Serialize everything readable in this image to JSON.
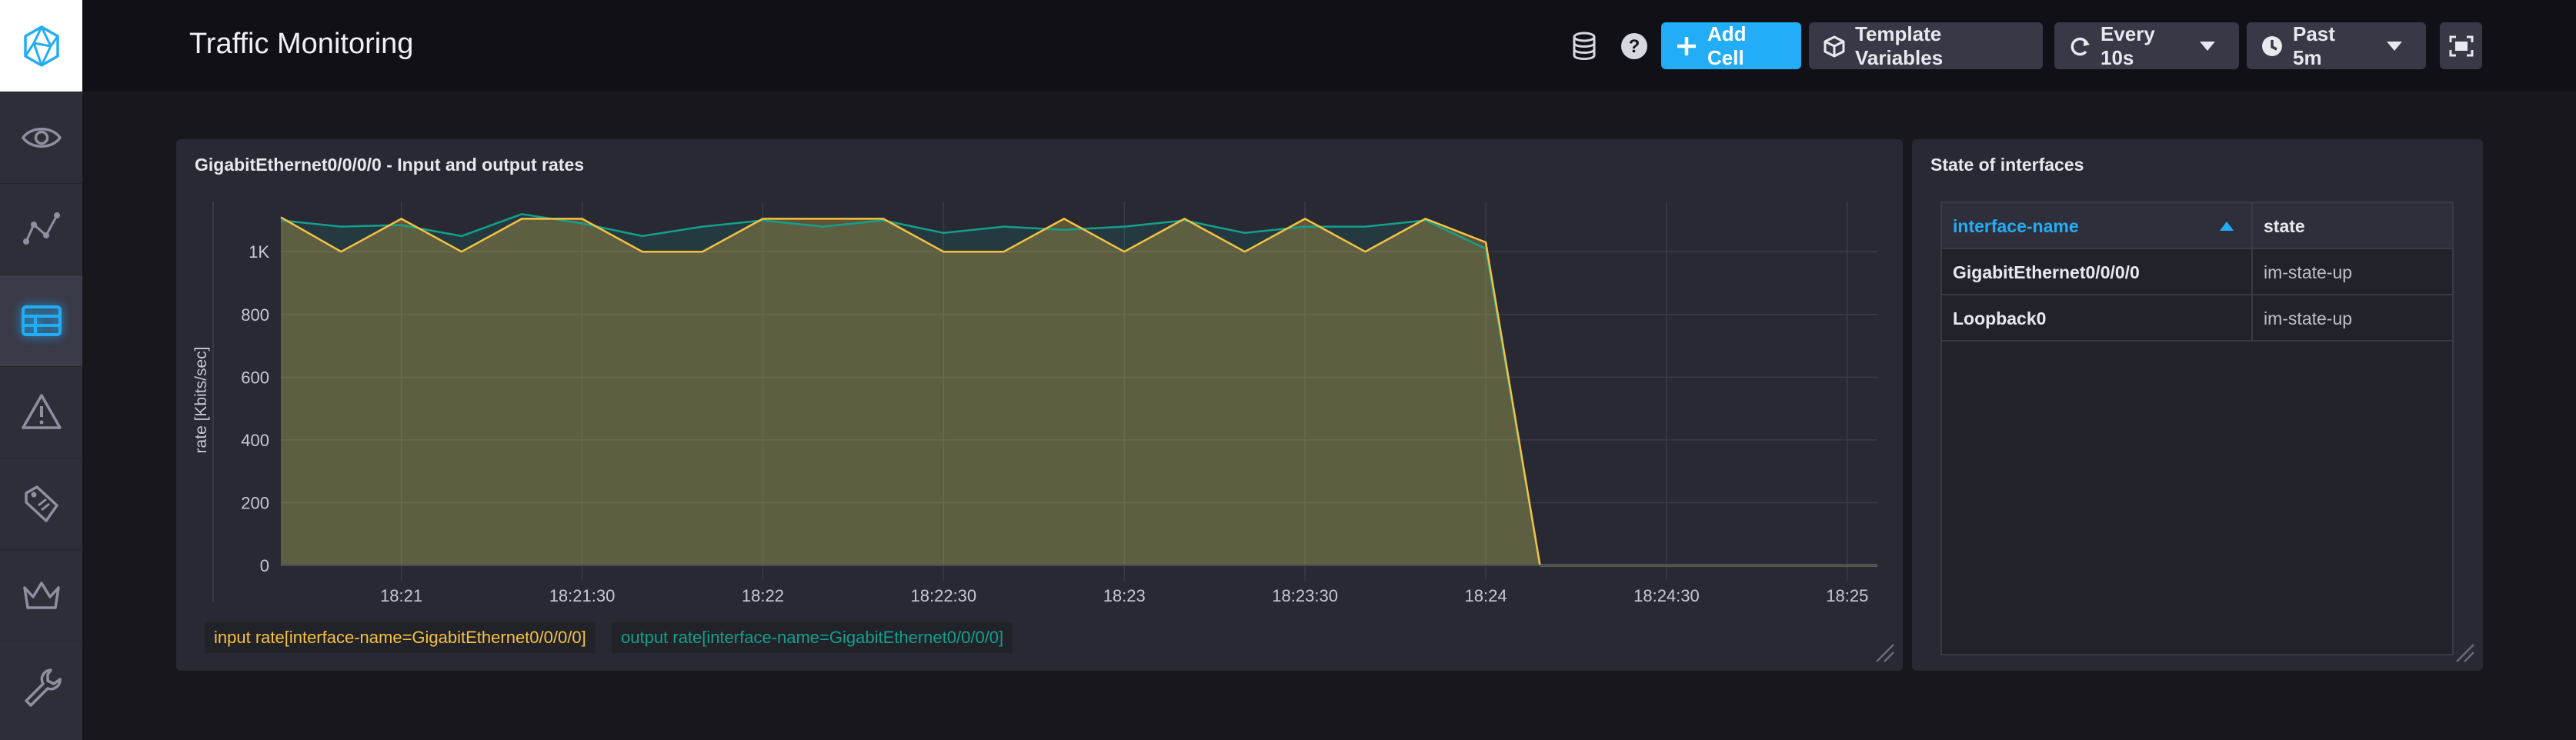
{
  "header": {
    "title": "Traffic Monitoring",
    "add_cell_label": "Add Cell",
    "template_variables_label": "Template Variables",
    "refresh_label": "Every 10s",
    "time_range_label": "Past 5m"
  },
  "sidebar": {
    "items": [
      {
        "icon": "eye-icon"
      },
      {
        "icon": "graph-icon"
      },
      {
        "icon": "dashboard-icon",
        "active": true
      },
      {
        "icon": "alert-icon"
      },
      {
        "icon": "tag-icon"
      },
      {
        "icon": "crown-icon"
      },
      {
        "icon": "wrench-icon"
      }
    ]
  },
  "colors": {
    "accent": "#22adf6",
    "input_series": "#f5c242",
    "output_series": "#12a08c",
    "state_up": "#bfbfc8"
  },
  "chart_cell": {
    "title": "GigabitEthernet0/0/0/0 - Input and output rates"
  },
  "chart_data": {
    "type": "area",
    "title": "GigabitEthernet0/0/0/0 - Input and output rates",
    "ylabel": "rate [Kbits/sec]",
    "xlabel": "",
    "ylim": [
      0,
      1160
    ],
    "xlim": [
      "18:20:40",
      "18:25:05"
    ],
    "y_ticks": [
      "0",
      "200",
      "400",
      "600",
      "800",
      "1K"
    ],
    "y_tick_values": [
      0,
      200,
      400,
      600,
      800,
      1000
    ],
    "x_ticks": [
      "18:21",
      "18:21:30",
      "18:22",
      "18:22:30",
      "18:23",
      "18:23:30",
      "18:24",
      "18:24:30",
      "18:25"
    ],
    "x_tick_times": [
      "18:21:00",
      "18:21:30",
      "18:22:00",
      "18:22:30",
      "18:23:00",
      "18:23:30",
      "18:24:00",
      "18:24:30",
      "18:25:00"
    ],
    "grid": true,
    "legend_position": "bottom-left",
    "series": [
      {
        "name": "input rate[interface-name=GigabitEthernet0/0/0/0]",
        "color": "#f5c242",
        "points": [
          [
            "18:20:40",
            1110
          ],
          [
            "18:20:50",
            1000
          ],
          [
            "18:21:00",
            1105
          ],
          [
            "18:21:10",
            1000
          ],
          [
            "18:21:20",
            1105
          ],
          [
            "18:21:30",
            1105
          ],
          [
            "18:21:40",
            1000
          ],
          [
            "18:21:50",
            1000
          ],
          [
            "18:22:00",
            1105
          ],
          [
            "18:22:10",
            1105
          ],
          [
            "18:22:20",
            1105
          ],
          [
            "18:22:30",
            1000
          ],
          [
            "18:22:40",
            1000
          ],
          [
            "18:22:50",
            1105
          ],
          [
            "18:23:00",
            1000
          ],
          [
            "18:23:10",
            1105
          ],
          [
            "18:23:20",
            1000
          ],
          [
            "18:23:30",
            1105
          ],
          [
            "18:23:40",
            1000
          ],
          [
            "18:23:50",
            1105
          ],
          [
            "18:24:00",
            1030
          ],
          [
            "18:24:09",
            0
          ],
          [
            "18:25:05",
            0
          ]
        ]
      },
      {
        "name": "output rate[interface-name=GigabitEthernet0/0/0/0]",
        "color": "#12a08c",
        "points": [
          [
            "18:20:40",
            1100
          ],
          [
            "18:20:50",
            1080
          ],
          [
            "18:21:00",
            1085
          ],
          [
            "18:21:10",
            1050
          ],
          [
            "18:21:20",
            1120
          ],
          [
            "18:21:30",
            1090
          ],
          [
            "18:21:40",
            1050
          ],
          [
            "18:21:50",
            1080
          ],
          [
            "18:22:00",
            1100
          ],
          [
            "18:22:10",
            1080
          ],
          [
            "18:22:20",
            1100
          ],
          [
            "18:22:30",
            1060
          ],
          [
            "18:22:40",
            1080
          ],
          [
            "18:22:50",
            1070
          ],
          [
            "18:23:00",
            1080
          ],
          [
            "18:23:10",
            1100
          ],
          [
            "18:23:20",
            1060
          ],
          [
            "18:23:30",
            1080
          ],
          [
            "18:23:40",
            1080
          ],
          [
            "18:23:50",
            1100
          ],
          [
            "18:24:00",
            1010
          ],
          [
            "18:24:09",
            0
          ],
          [
            "18:25:05",
            0
          ]
        ]
      }
    ]
  },
  "state_cell": {
    "title": "State of interfaces",
    "columns": [
      "interface-name",
      "state"
    ],
    "rows": [
      {
        "interface": "GigabitEthernet0/0/0/0",
        "state": "im-state-up"
      },
      {
        "interface": "Loopback0",
        "state": "im-state-up"
      }
    ]
  }
}
